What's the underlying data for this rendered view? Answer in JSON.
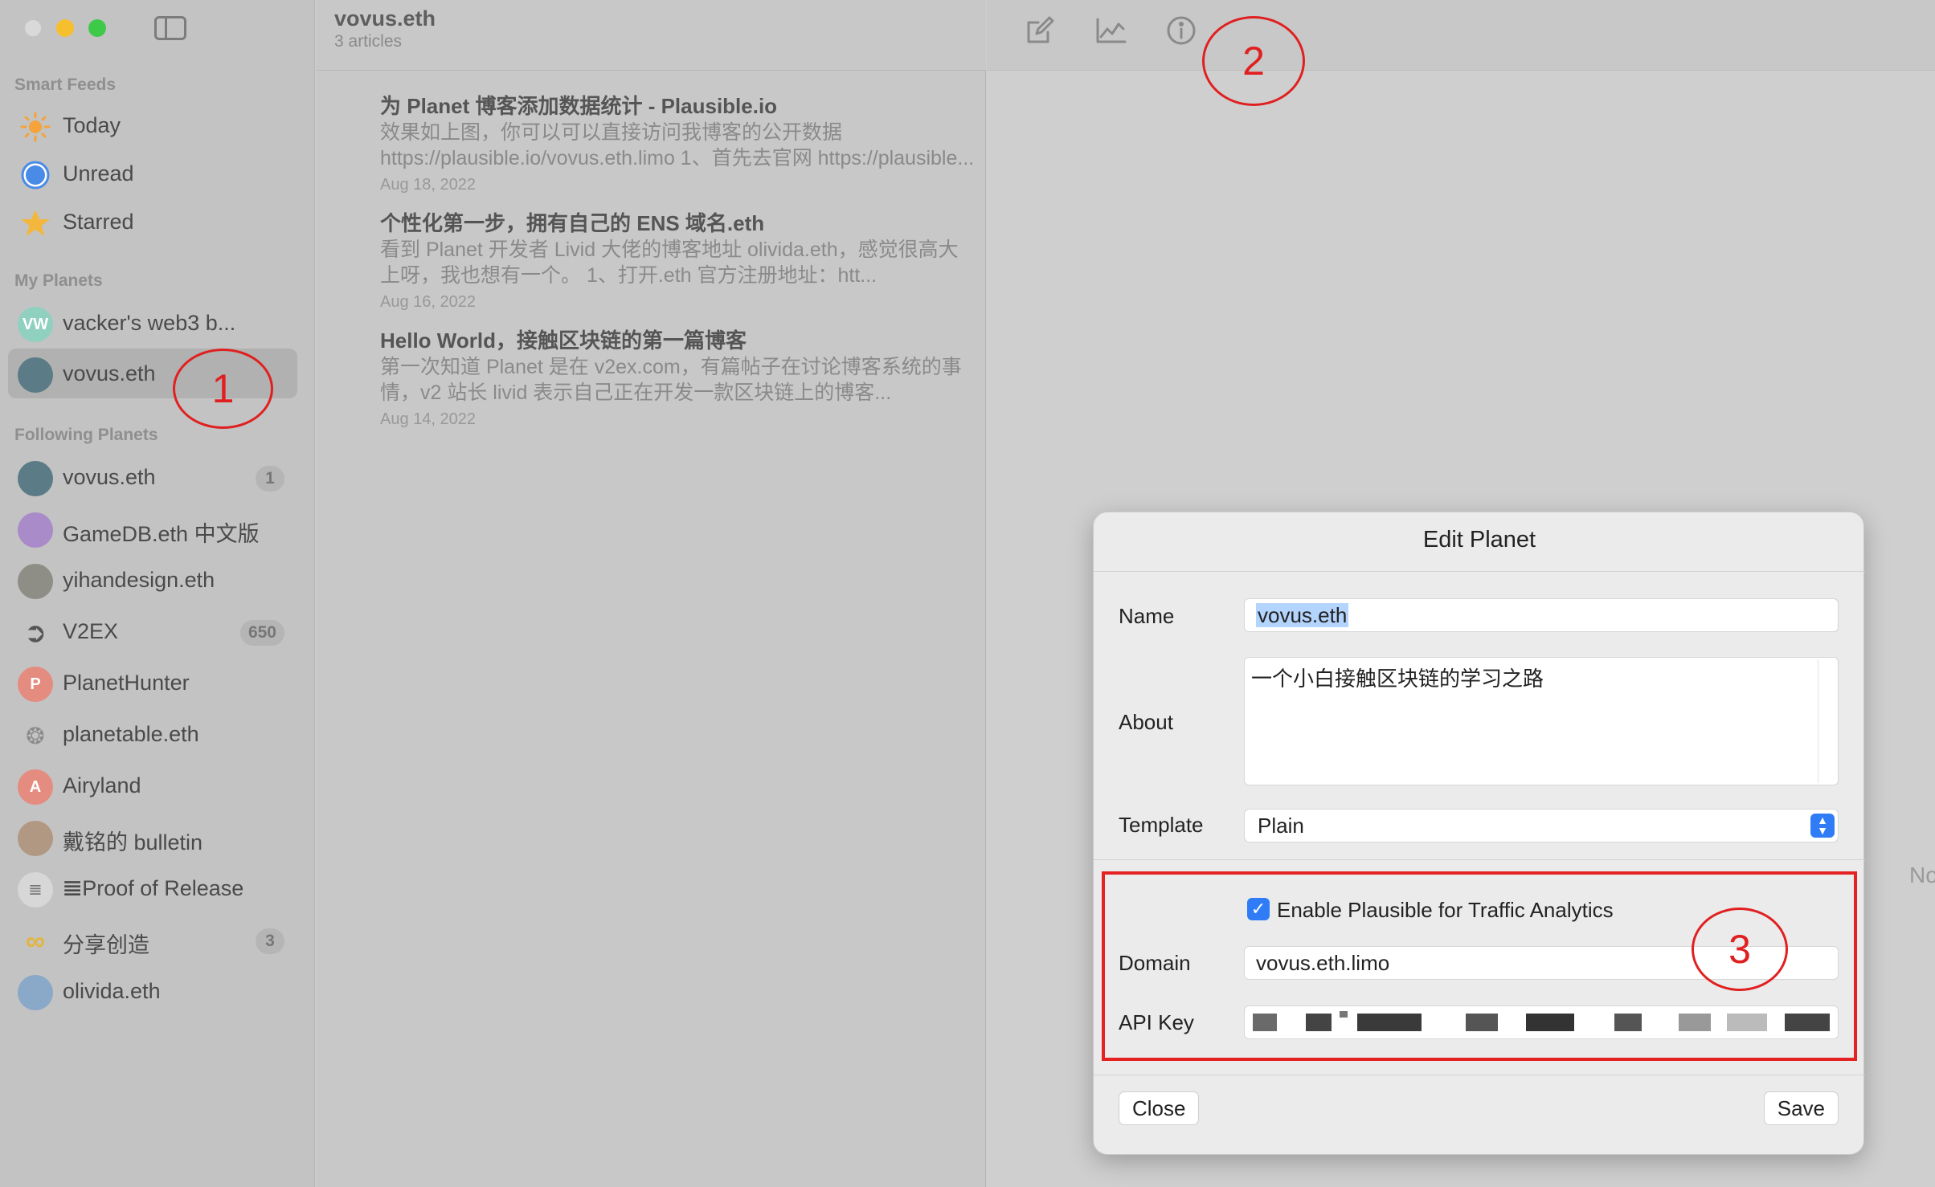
{
  "sidebar": {
    "smart_feeds_title": "Smart Feeds",
    "smart_feeds": [
      {
        "label": "Today",
        "icon": "sun-icon"
      },
      {
        "label": "Unread",
        "icon": "unread-dot-icon"
      },
      {
        "label": "Starred",
        "icon": "star-icon"
      }
    ],
    "my_planets_title": "My Planets",
    "my_planets": [
      {
        "label": "vacker's web3 b...",
        "avatar_text": "VW",
        "selected": false
      },
      {
        "label": "vovus.eth",
        "avatar_text": "",
        "selected": true
      }
    ],
    "following_title": "Following Planets",
    "following": [
      {
        "label": "vovus.eth",
        "avatar_text": "",
        "count": "1"
      },
      {
        "label": "GameDB.eth 中文版",
        "avatar_text": "",
        "count": ""
      },
      {
        "label": "yihandesign.eth",
        "avatar_text": "",
        "count": ""
      },
      {
        "label": "V2EX",
        "avatar_text": "",
        "count": "650"
      },
      {
        "label": "PlanetHunter",
        "avatar_text": "P",
        "count": ""
      },
      {
        "label": "planetable.eth",
        "avatar_text": "",
        "count": ""
      },
      {
        "label": "Airyland",
        "avatar_text": "A",
        "count": ""
      },
      {
        "label": "戴铭的 bulletin",
        "avatar_text": "",
        "count": ""
      },
      {
        "label": "𝌆Proof of Release",
        "avatar_text": "",
        "count": ""
      },
      {
        "label": "分享创造",
        "avatar_text": "",
        "count": "3"
      },
      {
        "label": "olivida.eth",
        "avatar_text": "",
        "count": ""
      }
    ]
  },
  "article_list": {
    "title": "vovus.eth",
    "subtitle": "3 articles",
    "articles": [
      {
        "title": "为 Planet 博客添加数据统计 - Plausible.io",
        "summary": "效果如上图，你可以可以直接访问我博客的公开数据 https://plausible.io/vovus.eth.limo 1、首先去官网 https://plausible...",
        "date": "Aug 18, 2022"
      },
      {
        "title": "个性化第一步，拥有自己的 ENS 域名.eth",
        "summary": "看到 Planet 开发者 Livid 大佬的博客地址 olivida.eth，感觉很高大上呀，我也想有一个。 1、打开.eth 官方注册地址：htt...",
        "date": "Aug 16, 2022"
      },
      {
        "title": "Hello World，接触区块链的第一篇博客",
        "summary": "第一次知道 Planet 是在 v2ex.com，有篇帖子在讨论博客系统的事情，v2 站长 livid 表示自己正在开发一款区块链上的博客...",
        "date": "Aug 14, 2022"
      }
    ]
  },
  "toolbar": {
    "icons": [
      "compose-icon",
      "chart-icon",
      "info-icon"
    ]
  },
  "detail": {
    "side_text": "No"
  },
  "annotations": {
    "one": "1",
    "two": "2",
    "three": "3",
    "color": "#e02020"
  },
  "modal": {
    "title": "Edit Planet",
    "name_label": "Name",
    "name_value": "vovus.eth",
    "about_label": "About",
    "about_value": "一个小白接触区块链的学习之路",
    "template_label": "Template",
    "template_value": "Plain",
    "plausible_checkbox_label": "Enable Plausible for Traffic Analytics",
    "plausible_checked": true,
    "domain_label": "Domain",
    "domain_value": "vovus.eth.limo",
    "api_key_label": "API Key",
    "close_label": "Close",
    "save_label": "Save"
  },
  "colors": {
    "accent": "#2f7cf6",
    "annotation_red": "#e02020",
    "sidebar_bg": "#c3c3c3"
  }
}
